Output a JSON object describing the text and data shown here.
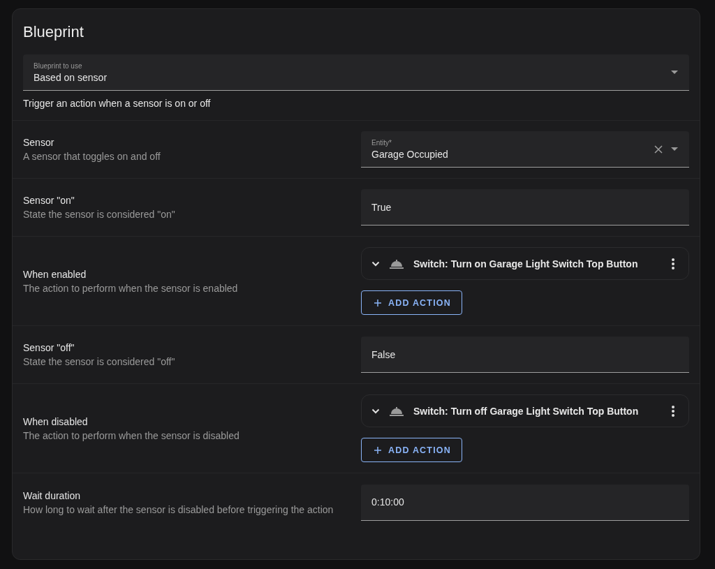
{
  "card": {
    "title": "Blueprint",
    "blueprint_select": {
      "label": "Blueprint to use",
      "value": "Based on sensor"
    },
    "description": "Trigger an action when a sensor is on or off"
  },
  "inputs": [
    {
      "kind": "entity",
      "name": "Sensor",
      "description": "A sensor that toggles on and off",
      "label": "Entity*",
      "value": "Garage Occupied"
    },
    {
      "kind": "text",
      "name": "Sensor \"on\"",
      "description": "State the sensor is considered \"on\"",
      "value": "True"
    },
    {
      "kind": "action",
      "name": "When enabled",
      "description": "The action to perform when the sensor is enabled",
      "actions": [
        {
          "title": "Switch: Turn on Garage Light Switch Top Button"
        }
      ],
      "add_button": "ADD ACTION"
    },
    {
      "kind": "text",
      "name": "Sensor \"off\"",
      "description": "State the sensor is considered \"off\"",
      "value": "False"
    },
    {
      "kind": "action",
      "name": "When disabled",
      "description": "The action to perform when the sensor is disabled",
      "actions": [
        {
          "title": "Switch: Turn off Garage Light Switch Top Button"
        }
      ],
      "add_button": "ADD ACTION"
    },
    {
      "kind": "text",
      "name": "Wait duration",
      "description": "How long to wait after the sensor is disabled before triggering the action",
      "value": "0:10:00"
    }
  ]
}
